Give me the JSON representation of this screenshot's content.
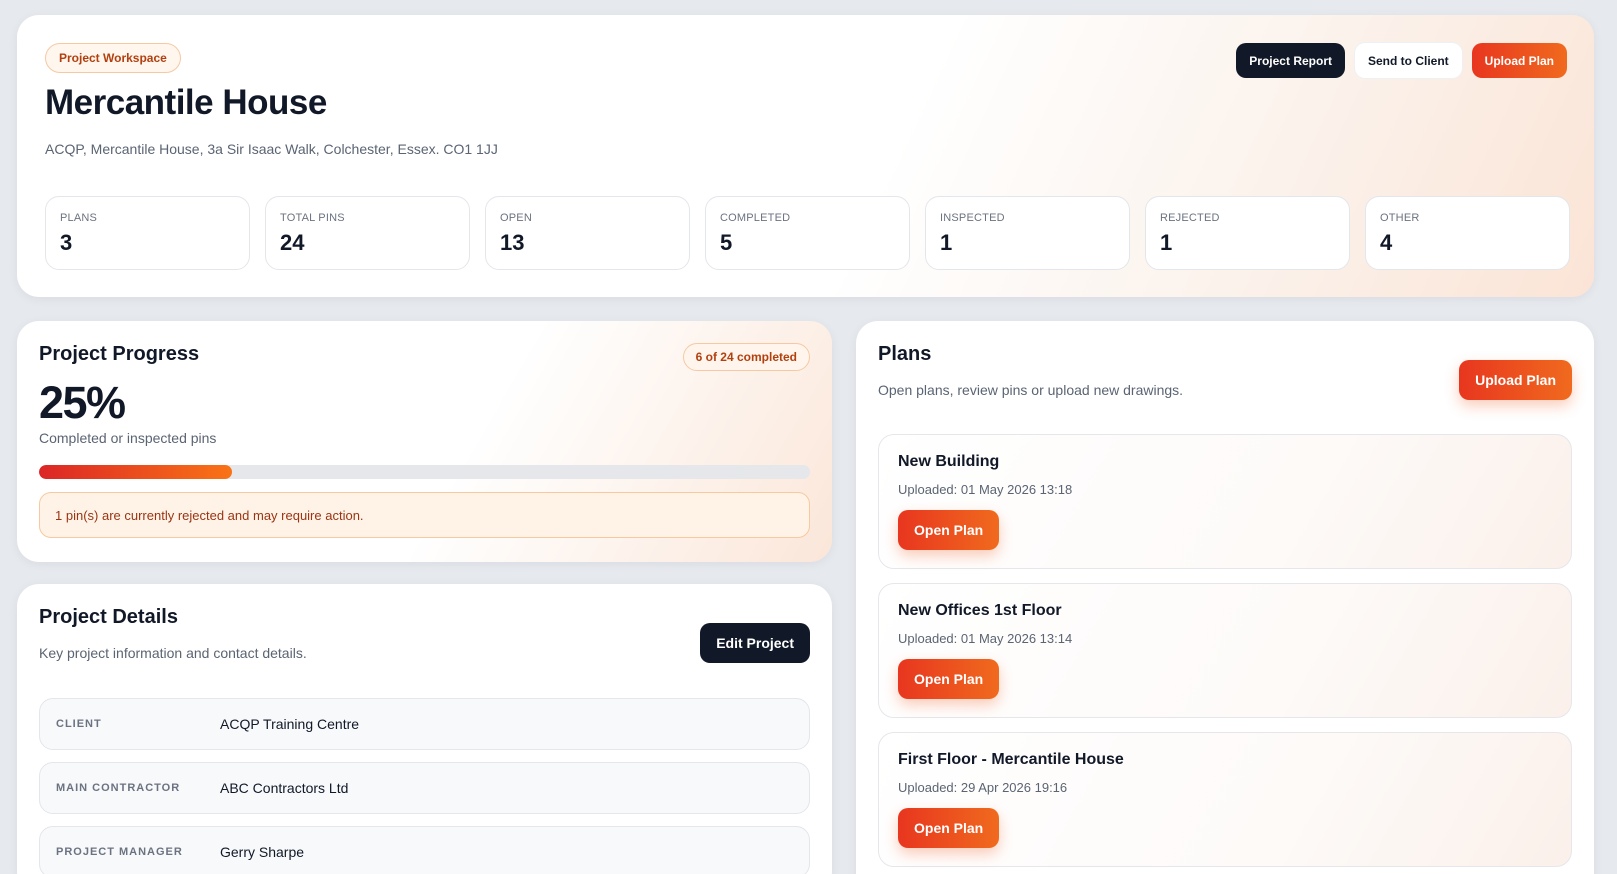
{
  "header": {
    "badge": "Project Workspace",
    "title": "Mercantile House",
    "address": "ACQP, Mercantile House, 3a Sir Isaac Walk, Colchester, Essex. CO1 1JJ",
    "actions": {
      "report": "Project Report",
      "send": "Send to Client",
      "upload": "Upload Plan"
    }
  },
  "stats": [
    {
      "label": "PLANS",
      "value": "3"
    },
    {
      "label": "TOTAL PINS",
      "value": "24"
    },
    {
      "label": "OPEN",
      "value": "13"
    },
    {
      "label": "COMPLETED",
      "value": "5"
    },
    {
      "label": "INSPECTED",
      "value": "1"
    },
    {
      "label": "REJECTED",
      "value": "1"
    },
    {
      "label": "OTHER",
      "value": "4"
    }
  ],
  "progress": {
    "title": "Project Progress",
    "completed_badge": "6 of 24 completed",
    "percent_label": "25%",
    "percent_value": 0.25,
    "subtitle": "Completed or inspected pins",
    "alert": "1 pin(s) are currently rejected and may require action."
  },
  "details": {
    "title": "Project Details",
    "subtitle": "Key project information and contact details.",
    "edit_label": "Edit Project",
    "rows": [
      {
        "label": "CLIENT",
        "value": "ACQP Training Centre"
      },
      {
        "label": "MAIN CONTRACTOR",
        "value": "ABC Contractors Ltd"
      },
      {
        "label": "PROJECT MANAGER",
        "value": "Gerry Sharpe"
      }
    ]
  },
  "plans": {
    "title": "Plans",
    "subtitle": "Open plans, review pins or upload new drawings.",
    "upload_label": "Upload Plan",
    "items": [
      {
        "name": "New Building",
        "uploaded": "Uploaded: 01 May 2026 13:18",
        "open_label": "Open Plan"
      },
      {
        "name": "New Offices 1st Floor",
        "uploaded": "Uploaded: 01 May 2026 13:14",
        "open_label": "Open Plan"
      },
      {
        "name": "First Floor - Mercantile House",
        "uploaded": "Uploaded: 29 Apr 2026 19:16",
        "open_label": "Open Plan"
      }
    ]
  },
  "colors": {
    "accent": "#f06a1e",
    "accent_deep": "#e8361f",
    "dark": "#111827",
    "background": "#e6e9ee"
  }
}
